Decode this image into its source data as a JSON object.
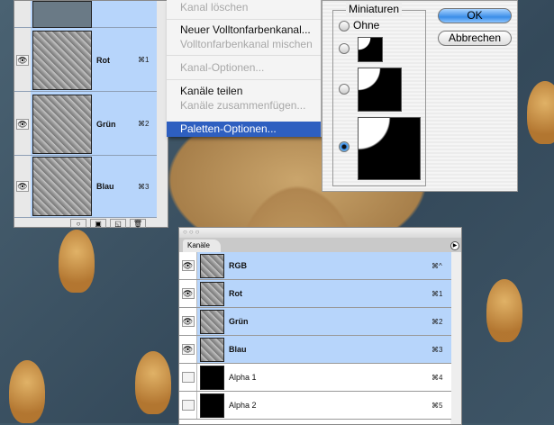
{
  "left_panel": {
    "rows": [
      {
        "name": "Rot",
        "shortcut": "⌘1"
      },
      {
        "name": "Grün",
        "shortcut": "⌘2"
      },
      {
        "name": "Blau",
        "shortcut": "⌘3"
      }
    ]
  },
  "menu": {
    "items": [
      {
        "label": "Kanal löschen",
        "enabled": false
      },
      {
        "label": "Neuer Volltonfarbenkanal...",
        "enabled": true
      },
      {
        "label": "Volltonfarbenkanal mischen",
        "enabled": false
      },
      {
        "label": "Kanal-Optionen...",
        "enabled": false
      },
      {
        "label": "Kanäle teilen",
        "enabled": true
      },
      {
        "label": "Kanäle zusammenfügen...",
        "enabled": false
      },
      {
        "label": "Paletten-Optionen...",
        "enabled": true,
        "highlighted": true
      }
    ]
  },
  "dialog": {
    "group_label": "Miniaturen",
    "option_none": "Ohne",
    "selected_option": "large",
    "ok": "OK",
    "cancel": "Abbrechen"
  },
  "channels_panel": {
    "tab": "Kanäle",
    "rows": [
      {
        "name": "RGB",
        "shortcut": "⌘^",
        "visible": true
      },
      {
        "name": "Rot",
        "shortcut": "⌘1",
        "visible": true
      },
      {
        "name": "Grün",
        "shortcut": "⌘2",
        "visible": true
      },
      {
        "name": "Blau",
        "shortcut": "⌘3",
        "visible": true
      },
      {
        "name": "Alpha 1",
        "shortcut": "⌘4",
        "visible": false
      },
      {
        "name": "Alpha 2",
        "shortcut": "⌘5",
        "visible": false
      }
    ]
  },
  "colors": {
    "selection": "#b7d5fb",
    "menu_highlight": "#2e5fc0"
  }
}
